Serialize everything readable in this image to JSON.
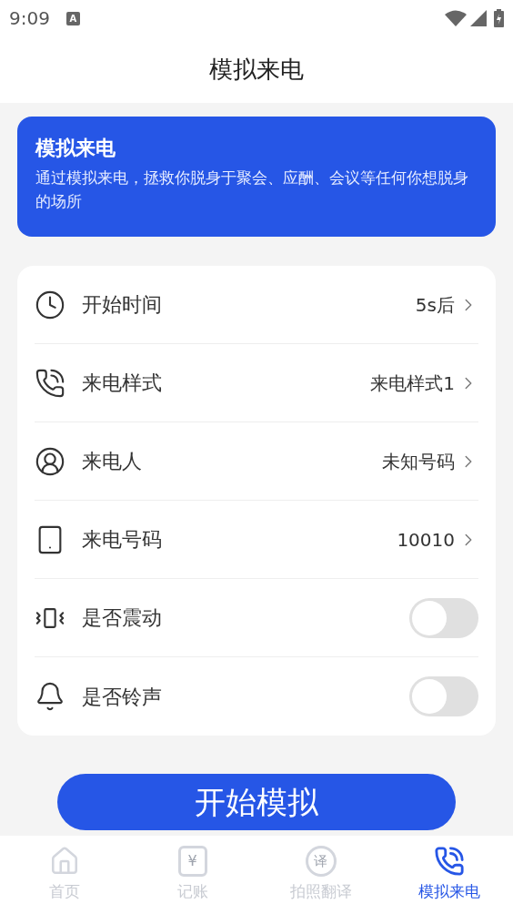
{
  "status_bar": {
    "time": "9:09",
    "notification_glyph": "A"
  },
  "header": {
    "title": "模拟来电"
  },
  "banner": {
    "title": "模拟来电",
    "text": "通过模拟来电，拯救你脱身于聚会、应酬、会议等任何你想脱身的场所"
  },
  "settings": [
    {
      "kind": "link",
      "label": "开始时间",
      "value": "5s后"
    },
    {
      "kind": "link",
      "label": "来电样式",
      "value": "来电样式1"
    },
    {
      "kind": "link",
      "label": "来电人",
      "value": "未知号码"
    },
    {
      "kind": "link",
      "label": "来电号码",
      "value": "10010"
    },
    {
      "kind": "toggle",
      "label": "是否震动",
      "on": false
    },
    {
      "kind": "toggle",
      "label": "是否铃声",
      "on": false
    }
  ],
  "start_button": "开始模拟",
  "bottom_nav": [
    {
      "label": "首页",
      "selected": false
    },
    {
      "icon_text": "¥",
      "label": "记账",
      "selected": false
    },
    {
      "icon_text": "译",
      "label": "拍照翻译",
      "selected": false
    },
    {
      "label": "模拟来电",
      "selected": true
    }
  ]
}
